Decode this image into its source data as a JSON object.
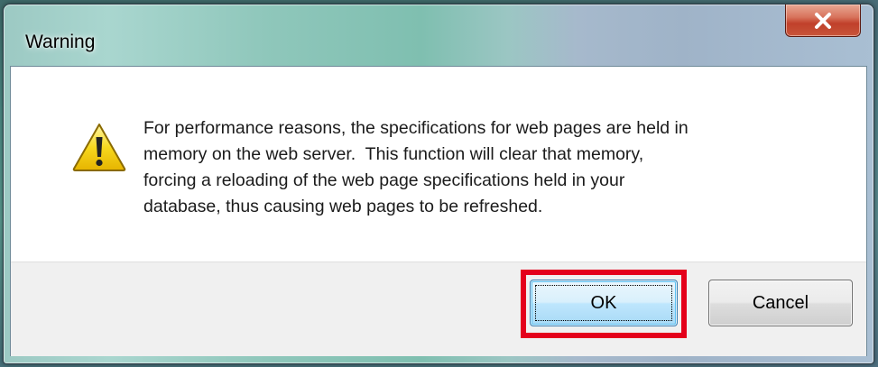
{
  "window": {
    "title": "Warning",
    "close_label": "X"
  },
  "dialog": {
    "icon": "warning-triangle-icon",
    "message": "For performance reasons, the specifications for web pages are held in\nmemory on the web server.  This function will clear that memory,\nforcing a reloading of the web page specifications held in your\ndatabase, thus causing web pages to be refreshed."
  },
  "buttons": {
    "ok_label": "OK",
    "cancel_label": "Cancel"
  },
  "colors": {
    "highlight": "#e4001b",
    "warning_yellow": "#f5d100",
    "close_red": "#c8442c"
  }
}
